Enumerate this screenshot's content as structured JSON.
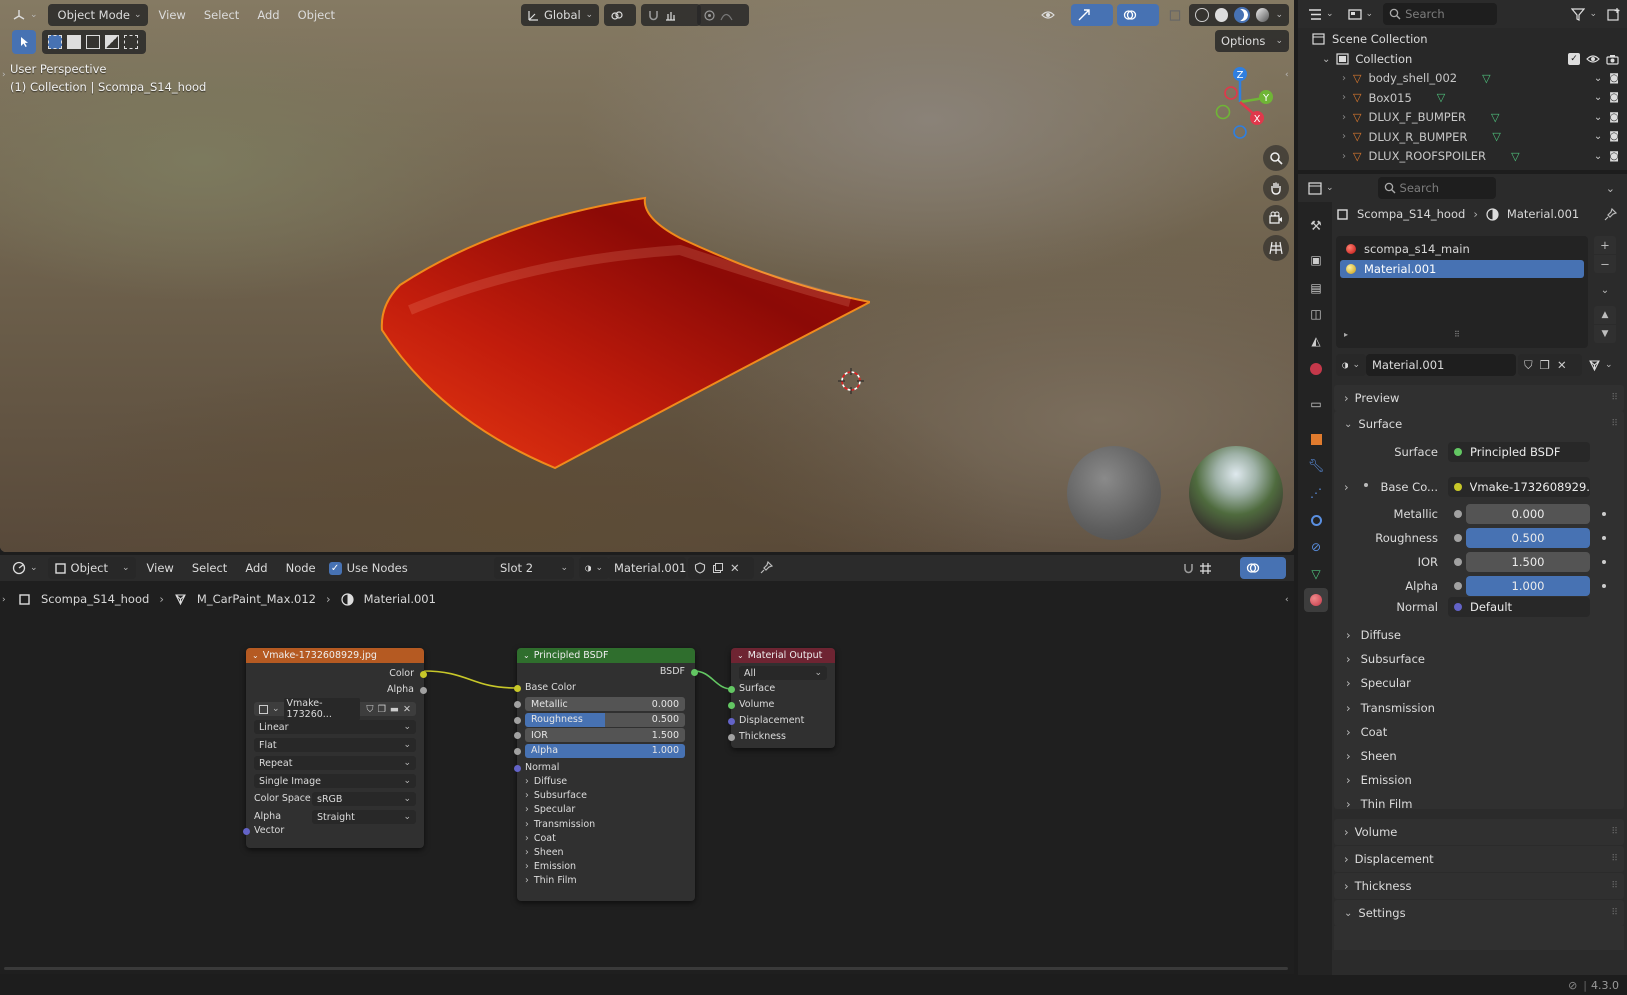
{
  "viewport": {
    "mode": "Object Mode",
    "menus": [
      "View",
      "Select",
      "Add",
      "Object"
    ],
    "transform_orientation": "Global",
    "options_label": "Options",
    "perspective_label": "User Perspective",
    "collection_label": "(1) Collection | Scompa_S14_hood",
    "gizmo_axes": [
      "Z",
      "Y",
      "X"
    ]
  },
  "node_editor": {
    "editor_type": "Object",
    "menus": [
      "View",
      "Select",
      "Add",
      "Node"
    ],
    "use_nodes_label": "Use Nodes",
    "use_nodes_checked": true,
    "slot": "Slot 2",
    "material": "Material.001",
    "breadcrumb": [
      "Scompa_S14_hood",
      "M_CarPaint_Max.012",
      "Material.001"
    ],
    "image_node": {
      "title": "Vmake-1732608929.jpg",
      "outputs": [
        "Color",
        "Alpha"
      ],
      "image_name": "Vmake-173260...",
      "interpolation": "Linear",
      "projection": "Flat",
      "extension": "Repeat",
      "source": "Single Image",
      "color_space_label": "Color Space",
      "color_space": "sRGB",
      "alpha_label": "Alpha",
      "alpha_mode": "Straight",
      "input": "Vector"
    },
    "bsdf_node": {
      "title": "Principled BSDF",
      "output": "BSDF",
      "base_color": "Base Color",
      "fields": [
        {
          "label": "Metallic",
          "value": "0.000",
          "fill": 0.0
        },
        {
          "label": "Roughness",
          "value": "0.500",
          "fill": 0.5
        },
        {
          "label": "IOR",
          "value": "1.500",
          "fill": 0.0
        },
        {
          "label": "Alpha",
          "value": "1.000",
          "fill": 1.0
        }
      ],
      "normal": "Normal",
      "sections": [
        "Diffuse",
        "Subsurface",
        "Specular",
        "Transmission",
        "Coat",
        "Sheen",
        "Emission",
        "Thin Film"
      ]
    },
    "output_node": {
      "title": "Material Output",
      "target": "All",
      "inputs": [
        "Surface",
        "Volume",
        "Displacement",
        "Thickness"
      ]
    }
  },
  "outliner": {
    "search_placeholder": "Search",
    "scene_collection": "Scene Collection",
    "collection": "Collection",
    "items": [
      "body_shell_002",
      "Box015",
      "DLUX_F_BUMPER",
      "DLUX_R_BUMPER",
      "DLUX_ROOFSPOILER"
    ]
  },
  "properties": {
    "search_placeholder": "Search",
    "breadcrumb_object": "Scompa_S14_hood",
    "breadcrumb_material": "Material.001",
    "slots": [
      "scompa_s14_main",
      "Material.001"
    ],
    "selected_slot": 1,
    "material_name": "Material.001",
    "panels": {
      "preview": "Preview",
      "surface": "Surface",
      "volume": "Volume",
      "displacement": "Displacement",
      "thickness": "Thickness",
      "settings": "Settings"
    },
    "surface_label": "Surface",
    "surface_value": "Principled BSDF",
    "base_color_label": "Base Co...",
    "base_color_value": "Vmake-1732608929...",
    "fields": [
      {
        "label": "Metallic",
        "value": "0.000",
        "fill": 0.0
      },
      {
        "label": "Roughness",
        "value": "0.500",
        "fill": 1.0
      },
      {
        "label": "IOR",
        "value": "1.500",
        "fill": 0.0
      },
      {
        "label": "Alpha",
        "value": "1.000",
        "fill": 1.0
      }
    ],
    "normal_label": "Normal",
    "normal_value": "Default",
    "subsections": [
      "Diffuse",
      "Subsurface",
      "Specular",
      "Transmission",
      "Coat",
      "Sheen",
      "Emission",
      "Thin Film"
    ]
  },
  "status": {
    "version": "4.3.0"
  },
  "colors": {
    "accent": "#4772b3",
    "hood_red": "#c41a0a",
    "selection_outline": "#f08a1c",
    "image_node_header": "#b55a22",
    "bsdf_node_header": "#2f6e2d",
    "output_node_header": "#6e2432",
    "socket_yellow": "#c7c729",
    "socket_green": "#63c763",
    "socket_gray": "#a1a1a1",
    "socket_purple": "#6363c7"
  }
}
